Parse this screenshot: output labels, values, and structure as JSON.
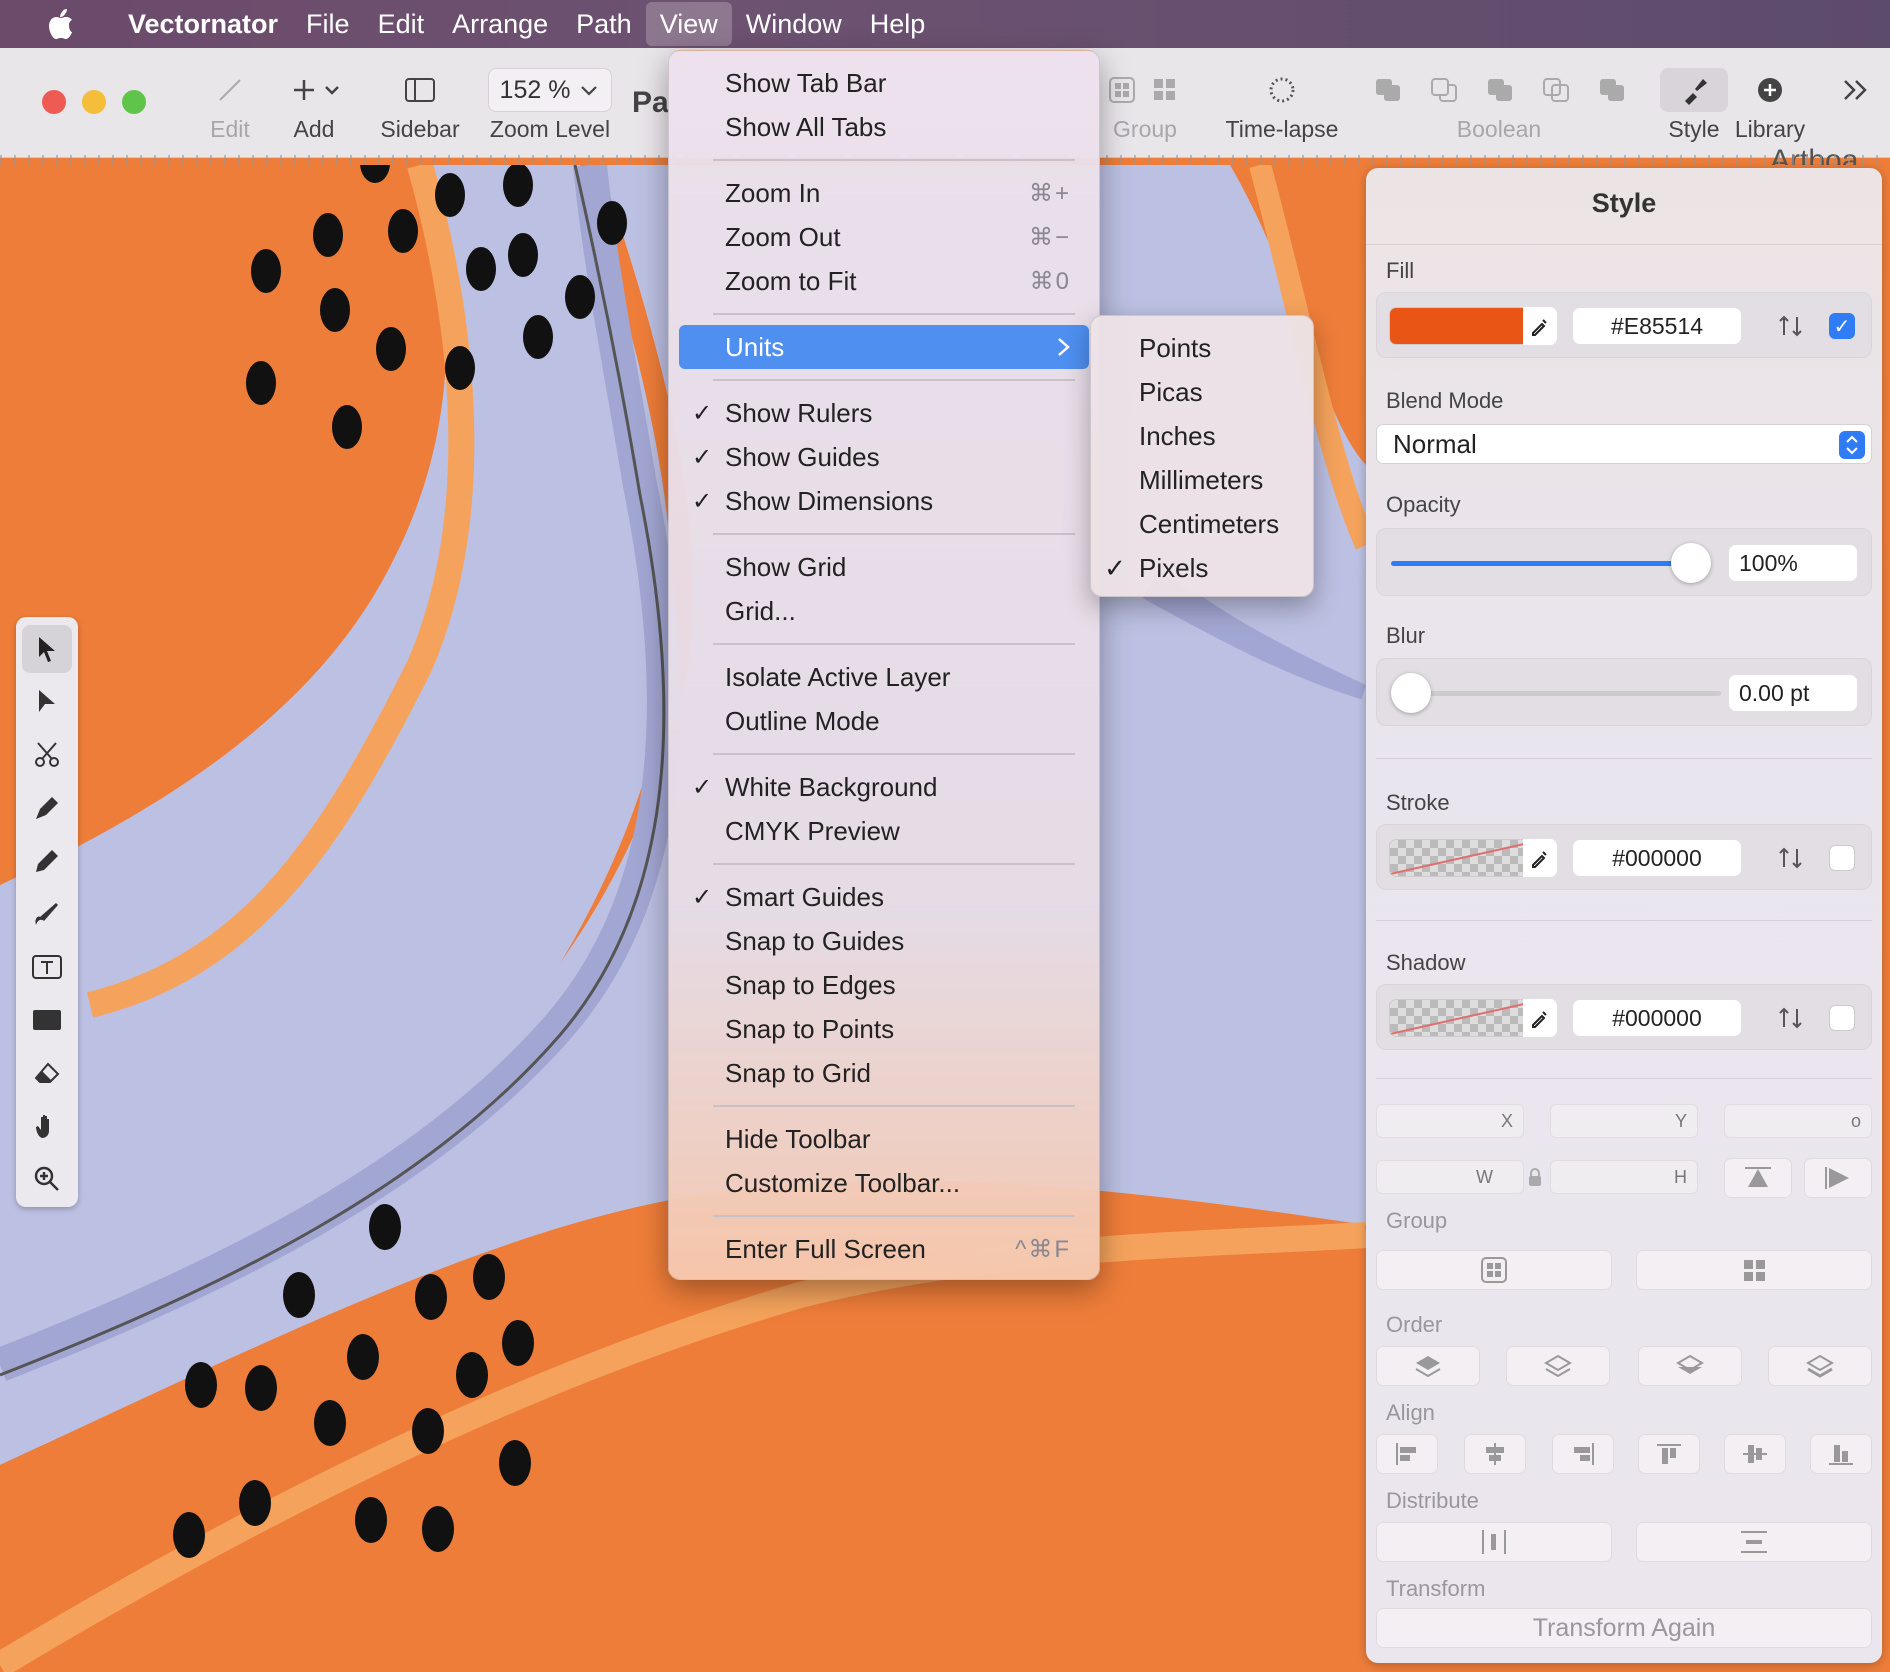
{
  "menubar": {
    "app_name": "Vectornator",
    "items": [
      "File",
      "Edit",
      "Arrange",
      "Path",
      "View",
      "Window",
      "Help"
    ]
  },
  "toolbar": {
    "edit_label": "Edit",
    "add_label": "Add",
    "sidebar_label": "Sidebar",
    "zoom_value": "152 %",
    "zoom_label": "Zoom Level",
    "doc_title_fragment": "Pa",
    "group_label": "Group",
    "timelapse_label": "Time-lapse",
    "boolean_label": "Boolean",
    "style_label": "Style",
    "library_label": "Library",
    "artboard_fragment": "Artboa"
  },
  "view_menu": {
    "items": [
      {
        "label": "Show Tab Bar",
        "checked": false,
        "shortcut": ""
      },
      {
        "label": "Show All Tabs",
        "checked": false,
        "shortcut": ""
      },
      {
        "label": "Zoom In",
        "checked": false,
        "shortcut": "⌘+"
      },
      {
        "label": "Zoom Out",
        "checked": false,
        "shortcut": "⌘−"
      },
      {
        "label": "Zoom to Fit",
        "checked": false,
        "shortcut": "⌘0"
      },
      {
        "label": "Units",
        "checked": false,
        "shortcut": "",
        "submenu": true
      },
      {
        "label": "Show Rulers",
        "checked": true,
        "shortcut": ""
      },
      {
        "label": "Show Guides",
        "checked": true,
        "shortcut": ""
      },
      {
        "label": "Show Dimensions",
        "checked": true,
        "shortcut": ""
      },
      {
        "label": "Show Grid",
        "checked": false,
        "shortcut": ""
      },
      {
        "label": "Grid...",
        "checked": false,
        "shortcut": ""
      },
      {
        "label": "Isolate Active Layer",
        "checked": false,
        "shortcut": ""
      },
      {
        "label": "Outline Mode",
        "checked": false,
        "shortcut": ""
      },
      {
        "label": "White Background",
        "checked": true,
        "shortcut": ""
      },
      {
        "label": "CMYK Preview",
        "checked": false,
        "shortcut": ""
      },
      {
        "label": "Smart Guides",
        "checked": true,
        "shortcut": ""
      },
      {
        "label": "Snap to Guides",
        "checked": false,
        "shortcut": ""
      },
      {
        "label": "Snap to Edges",
        "checked": false,
        "shortcut": ""
      },
      {
        "label": "Snap to Points",
        "checked": false,
        "shortcut": ""
      },
      {
        "label": "Snap to Grid",
        "checked": false,
        "shortcut": ""
      },
      {
        "label": "Hide Toolbar",
        "checked": false,
        "shortcut": ""
      },
      {
        "label": "Customize Toolbar...",
        "checked": false,
        "shortcut": ""
      },
      {
        "label": "Enter Full Screen",
        "checked": false,
        "shortcut": "^⌘F"
      }
    ],
    "check_glyph": "✓"
  },
  "units_menu": {
    "items": [
      {
        "label": "Points",
        "checked": false
      },
      {
        "label": "Picas",
        "checked": false
      },
      {
        "label": "Inches",
        "checked": false
      },
      {
        "label": "Millimeters",
        "checked": false
      },
      {
        "label": "Centimeters",
        "checked": false
      },
      {
        "label": "Pixels",
        "checked": true
      }
    ]
  },
  "style_panel": {
    "title": "Style",
    "fill": {
      "label": "Fill",
      "hex": "#E85514",
      "color": "#E85514",
      "enabled": true
    },
    "blend_mode": {
      "label": "Blend Mode",
      "value": "Normal"
    },
    "opacity": {
      "label": "Opacity",
      "value": "100%",
      "level": 1.0
    },
    "blur": {
      "label": "Blur",
      "value": "0.00 pt",
      "level": 0.0
    },
    "stroke": {
      "label": "Stroke",
      "hex": "#000000",
      "enabled": false
    },
    "shadow": {
      "label": "Shadow",
      "hex": "#000000",
      "enabled": false
    },
    "geometry": {
      "x_label": "X",
      "y_label": "Y",
      "angle_label": "o",
      "w_label": "W",
      "h_label": "H"
    },
    "group_label": "Group",
    "order_label": "Order",
    "align_label": "Align",
    "distribute_label": "Distribute",
    "transform_label": "Transform",
    "transform_again_label": "Transform Again"
  },
  "colors": {
    "canvas_orange": "#ee7d39",
    "light_orange": "#f5a35c",
    "lavender": "#bcc0e2",
    "lavender_dark": "#a2a6d2",
    "menu_highlight": "#4e8ff0",
    "checkbox_blue": "#2f7cf6"
  }
}
